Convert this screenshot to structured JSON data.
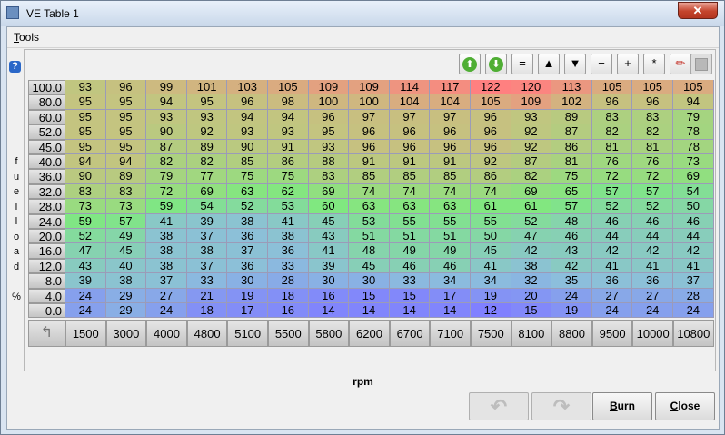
{
  "window": {
    "title": "VE Table 1"
  },
  "menu": {
    "tools_first": "T",
    "tools_rest": "ools"
  },
  "help_label": "?",
  "y_axis_label": [
    "f",
    "u",
    "e",
    "l",
    "l",
    "o",
    "a",
    "d",
    "",
    "%"
  ],
  "toolbar": [
    {
      "name": "up-arrow-circle-icon",
      "glyph": "⬆",
      "style": "go"
    },
    {
      "name": "down-arrow-circle-icon",
      "glyph": "⬇",
      "style": "go"
    },
    {
      "name": "equals-button",
      "glyph": "=",
      "style": "plain"
    },
    {
      "name": "increment-button",
      "glyph": "▲",
      "style": "plain"
    },
    {
      "name": "decrement-button",
      "glyph": "▼",
      "style": "plain"
    },
    {
      "name": "minus-button",
      "glyph": "−",
      "style": "plain"
    },
    {
      "name": "plus-button",
      "glyph": "+",
      "style": "plain"
    },
    {
      "name": "multiply-button",
      "glyph": "*",
      "style": "plain"
    },
    {
      "name": "pencil-icon",
      "glyph": "✏",
      "style": "plain"
    }
  ],
  "table": {
    "y_labels": [
      "100.0",
      "80.0",
      "60.0",
      "52.0",
      "45.0",
      "40.0",
      "36.0",
      "32.0",
      "28.0",
      "24.0",
      "20.0",
      "16.0",
      "12.0",
      "8.0",
      "4.0",
      "0.0"
    ],
    "x_labels": [
      "1500",
      "3000",
      "4000",
      "4800",
      "5100",
      "5500",
      "5800",
      "6200",
      "6700",
      "7100",
      "7500",
      "8100",
      "8800",
      "9500",
      "10000",
      "10800"
    ],
    "rows": [
      [
        93,
        96,
        99,
        101,
        103,
        105,
        109,
        109,
        114,
        117,
        122,
        120,
        113,
        105,
        105,
        105
      ],
      [
        95,
        95,
        94,
        95,
        96,
        98,
        100,
        100,
        104,
        104,
        105,
        109,
        102,
        96,
        96,
        94
      ],
      [
        95,
        95,
        93,
        93,
        94,
        94,
        96,
        97,
        97,
        97,
        96,
        93,
        89,
        83,
        83,
        79
      ],
      [
        95,
        95,
        90,
        92,
        93,
        93,
        95,
        96,
        96,
        96,
        96,
        92,
        87,
        82,
        82,
        78
      ],
      [
        95,
        95,
        87,
        89,
        90,
        91,
        93,
        96,
        96,
        96,
        96,
        92,
        86,
        81,
        81,
        78
      ],
      [
        94,
        94,
        82,
        82,
        85,
        86,
        88,
        91,
        91,
        91,
        92,
        87,
        81,
        76,
        76,
        73
      ],
      [
        90,
        89,
        79,
        77,
        75,
        75,
        83,
        85,
        85,
        85,
        86,
        82,
        75,
        72,
        72,
        69
      ],
      [
        83,
        83,
        72,
        69,
        63,
        62,
        69,
        74,
        74,
        74,
        74,
        69,
        65,
        57,
        57,
        54
      ],
      [
        73,
        73,
        59,
        54,
        52,
        53,
        60,
        63,
        63,
        63,
        61,
        61,
        57,
        52,
        52,
        50
      ],
      [
        59,
        57,
        41,
        39,
        38,
        41,
        45,
        53,
        55,
        55,
        55,
        52,
        48,
        46,
        46,
        46
      ],
      [
        52,
        49,
        38,
        37,
        36,
        38,
        43,
        51,
        51,
        51,
        50,
        47,
        46,
        44,
        44,
        44
      ],
      [
        47,
        45,
        38,
        38,
        37,
        36,
        41,
        48,
        49,
        49,
        45,
        42,
        43,
        42,
        42,
        42
      ],
      [
        43,
        40,
        38,
        37,
        36,
        33,
        39,
        45,
        46,
        46,
        41,
        38,
        42,
        41,
        41,
        41
      ],
      [
        39,
        38,
        37,
        33,
        30,
        28,
        30,
        30,
        33,
        34,
        34,
        32,
        35,
        36,
        36,
        37
      ],
      [
        24,
        29,
        27,
        21,
        19,
        18,
        16,
        15,
        15,
        17,
        19,
        20,
        24,
        27,
        27,
        28
      ],
      [
        24,
        29,
        24,
        18,
        17,
        16,
        14,
        14,
        14,
        14,
        12,
        15,
        19,
        24,
        24,
        24
      ]
    ]
  },
  "corner_glyph": "↰",
  "x_axis_label": "rpm",
  "buttons": {
    "undo_glyph": "↶",
    "redo_glyph": "↷",
    "burn_first": "B",
    "burn_rest": "urn",
    "close_first": "C",
    "close_rest": "lose"
  },
  "colors": {
    "title_close": "#c4442c",
    "accent_go": "#4fae34"
  }
}
